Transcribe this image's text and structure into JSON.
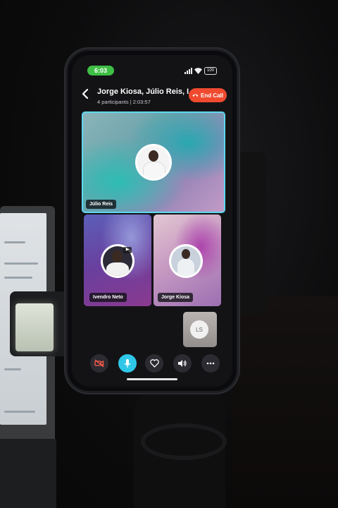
{
  "status_bar": {
    "time": "6:03",
    "battery": "100"
  },
  "call": {
    "title": "Jorge Kiosa, Júlio Reis, Iv...",
    "subtitle": "4 participants | 2:03:57",
    "end_call_label": "End Call"
  },
  "participants": {
    "main": {
      "name": "Júlio Reis"
    },
    "left": {
      "name": "Ivendro Neto"
    },
    "right": {
      "name": "Jorge Kiosa"
    },
    "self": {
      "initials": "LS"
    }
  },
  "controls": [
    {
      "icon": "video-off-icon"
    },
    {
      "icon": "microphone-icon",
      "active": true
    },
    {
      "icon": "heart-icon"
    },
    {
      "icon": "speaker-icon"
    },
    {
      "icon": "more-icon"
    }
  ],
  "colors": {
    "end_call": "#f04a2f",
    "active_control": "#2fc7e8",
    "active_speaker_border": "#5fd8f0",
    "time_pill": "#3fbf45"
  }
}
